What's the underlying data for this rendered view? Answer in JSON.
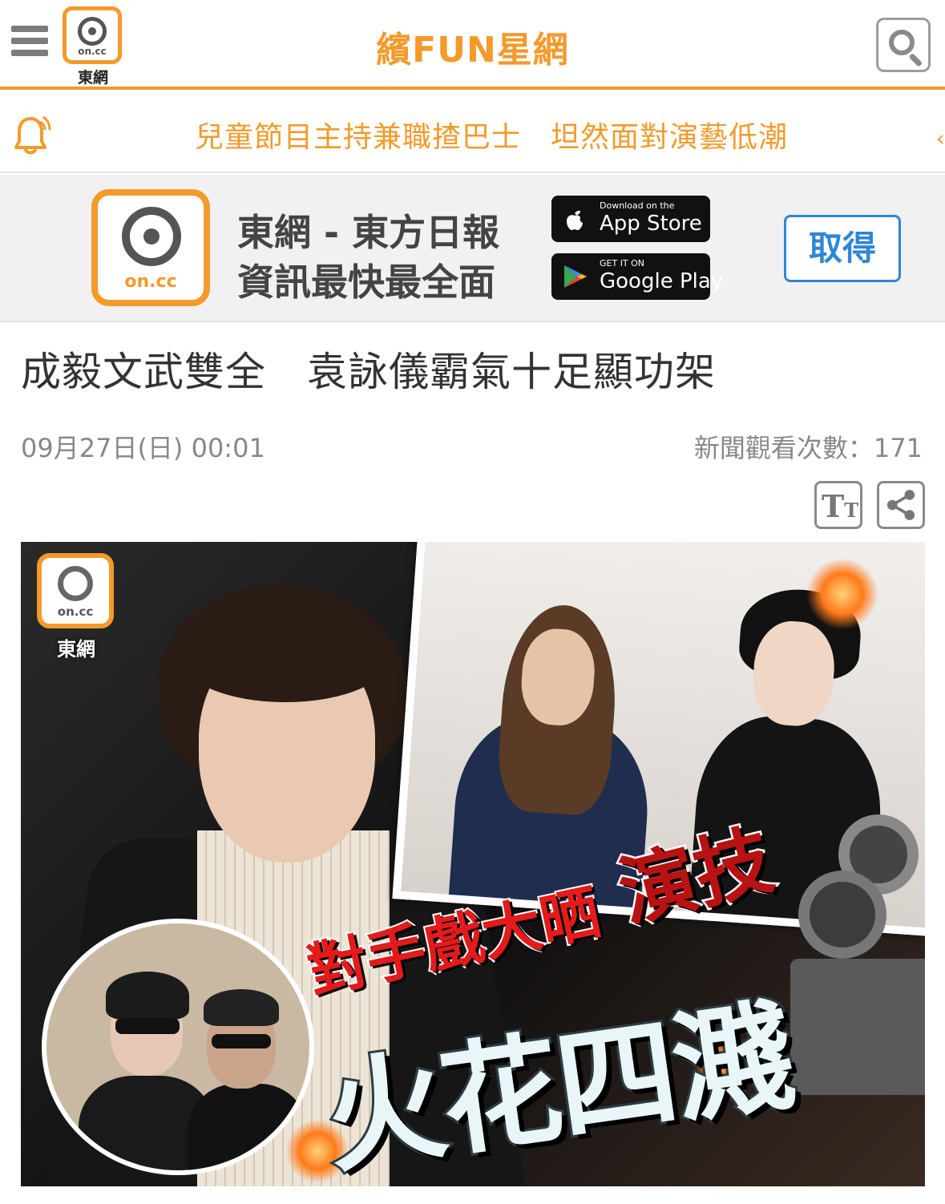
{
  "header": {
    "logo_text": "on.cc",
    "logo_caption": "東網",
    "site_title": "繽FUN星網"
  },
  "ticker": {
    "text": "兒童節目主持兼職揸巴士　坦然面對演藝低潮"
  },
  "app_banner": {
    "logo_text": "on.cc",
    "line1": "東網 - 東方日報",
    "line2": "資訊最快最全面",
    "app_store_small": "Download on the",
    "app_store_big": "App Store",
    "google_play_small": "GET IT ON",
    "google_play_big": "Google Play",
    "get_label": "取得"
  },
  "article": {
    "headline": "成毅文武雙全　袁詠儀霸氣十足顯功架",
    "date": "09月27日(日) 00:01",
    "views": "新聞觀看次數：171",
    "font_tool_label": "T",
    "font_tool_small": "T"
  },
  "hero": {
    "watermark_logo": "on.cc",
    "watermark_caption": "東網",
    "slogan1": "對手戲大晒",
    "slogan2": "演技",
    "slogan3": "火花四濺"
  },
  "colors": {
    "brand_orange": "#f39a2b",
    "get_blue": "#2f86d6"
  }
}
